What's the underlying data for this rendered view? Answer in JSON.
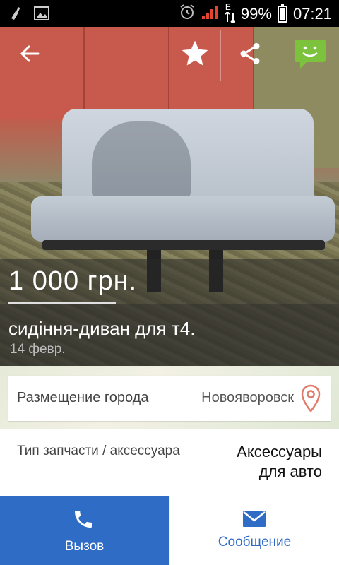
{
  "status_bar": {
    "battery": "99%",
    "time": "07:21",
    "network": "E"
  },
  "listing": {
    "price": "1 000 грн.",
    "title": "сидіння-диван для т4.",
    "date": "14  февр."
  },
  "location": {
    "label": "Размещение города",
    "value": "Новояворовск"
  },
  "spec": {
    "label": "Тип запчасти / аксессуара",
    "value_line1": "Аксессуары",
    "value_line2": "для авто"
  },
  "actions": {
    "call_label": "Вызов",
    "message_label": "Сообщение"
  },
  "colors": {
    "accent": "#2f6cc5",
    "chat_icon": "#7cc23d",
    "pin": "#e07a6c"
  },
  "icons": {
    "back": "back-arrow-icon",
    "favorite": "star-icon",
    "share": "share-icon",
    "chat": "chat-bubble-icon",
    "pin": "location-pin-icon",
    "phone": "phone-icon",
    "mail": "mail-icon"
  }
}
